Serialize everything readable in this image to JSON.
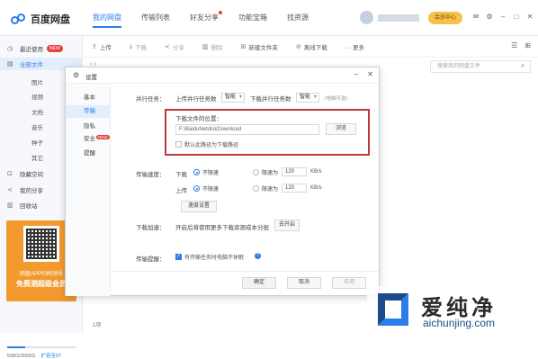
{
  "app": {
    "name": "百度网盘"
  },
  "nav": {
    "tabs": [
      {
        "label": "我的网盘",
        "active": true
      },
      {
        "label": "传输列表"
      },
      {
        "label": "好友分享",
        "dot": true
      },
      {
        "label": "功能宝箱"
      },
      {
        "label": "找资源"
      }
    ]
  },
  "header": {
    "vip_label": "会员中心",
    "icons": [
      "mail-icon",
      "settings-icon",
      "minimize-icon",
      "maximize-icon",
      "close-icon"
    ]
  },
  "toolbar": {
    "items": [
      {
        "icon": "upload-icon",
        "label": "上传"
      },
      {
        "icon": "download-icon",
        "label": "下载"
      },
      {
        "icon": "share-icon",
        "label": "分享"
      },
      {
        "icon": "delete-icon",
        "label": "删除"
      },
      {
        "icon": "new-folder-icon",
        "label": "新建文件夹"
      },
      {
        "icon": "offline-download-icon",
        "label": "离线下载"
      },
      {
        "icon": "more-icon",
        "label": "··· 更多"
      }
    ]
  },
  "search": {
    "placeholder": "搜索我的网盘文件"
  },
  "sidebar": {
    "recent": "最近使用",
    "recent_badge": "NEW",
    "all_files": "全部文件",
    "subitems": [
      "图片",
      "视频",
      "文档",
      "音乐",
      "种子",
      "其它"
    ],
    "hidden_space": "隐藏空间",
    "my_share": "我的分享",
    "recycle": "回收站",
    "promo_line1": "网盘APP扫码领号",
    "promo_line2": "免费测超级会员",
    "storage_text": "536G/2055G",
    "storage_expand": "扩容至5T",
    "storage_fraction": 0.26
  },
  "file_count": "1项",
  "dialog": {
    "title": "设置",
    "nav": [
      {
        "label": "基本"
      },
      {
        "label": "传输",
        "active": true
      },
      {
        "label": "隐私"
      },
      {
        "label": "安全",
        "badge": "NEW"
      },
      {
        "label": "提醒"
      }
    ],
    "tasks": {
      "label": "并行任务：",
      "upload_label": "上传并行任务数",
      "upload_value": "智能",
      "download_label": "下载并行任务数",
      "download_value": "智能",
      "hint": "（电脑可选）"
    },
    "download_dir": {
      "label": "下载文件的位置：",
      "path": "F:\\BaiduNetdiskDownload",
      "browse": "浏览",
      "default_check": "默认此路径为下载路径"
    },
    "speed": {
      "label": "传输速度：",
      "download_label": "下载",
      "upload_label": "上传",
      "unlimited": "不限速",
      "limit_to": "限速为",
      "download_value": "120",
      "upload_value": "120",
      "unit": "KB/s"
    },
    "advanced_button": "速度设置",
    "download_accel": {
      "label": "下载加速：",
      "text": "开启后将使用更多下载资源成本分担",
      "button": "去开启"
    },
    "transfer_tip": {
      "label": "传输提醒：",
      "check": "有传输任务时电脑不休眠"
    },
    "buttons": {
      "ok": "确定",
      "cancel": "取消",
      "apply": "应用"
    }
  },
  "watermark": {
    "title": "爱纯净",
    "url": "aichunjing.com"
  }
}
